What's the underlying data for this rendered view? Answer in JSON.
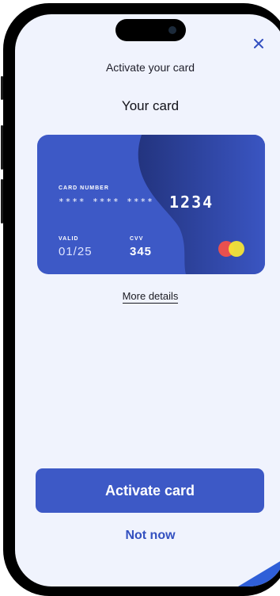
{
  "header": {
    "title": "Activate your card",
    "close_icon": "close-icon"
  },
  "section": {
    "title": "Your card"
  },
  "card": {
    "number_label": "CARD NUMBER",
    "masked_digits": "**** **** ****",
    "last_four": "1234",
    "valid_label": "VALID",
    "valid_value": "01/25",
    "cvv_label": "CVV",
    "cvv_value": "345",
    "brand_icon": "mastercard-logo-icon",
    "colors": {
      "base": "#3d59c6",
      "wave": "#2c3f96",
      "mc_red": "#e8504f",
      "mc_yellow": "#f4e437"
    }
  },
  "links": {
    "more_details": "More details"
  },
  "actions": {
    "activate_label": "Activate card",
    "not_now_label": "Not now"
  },
  "colors": {
    "accent": "#3d59c6",
    "background": "#f0f3fd"
  }
}
